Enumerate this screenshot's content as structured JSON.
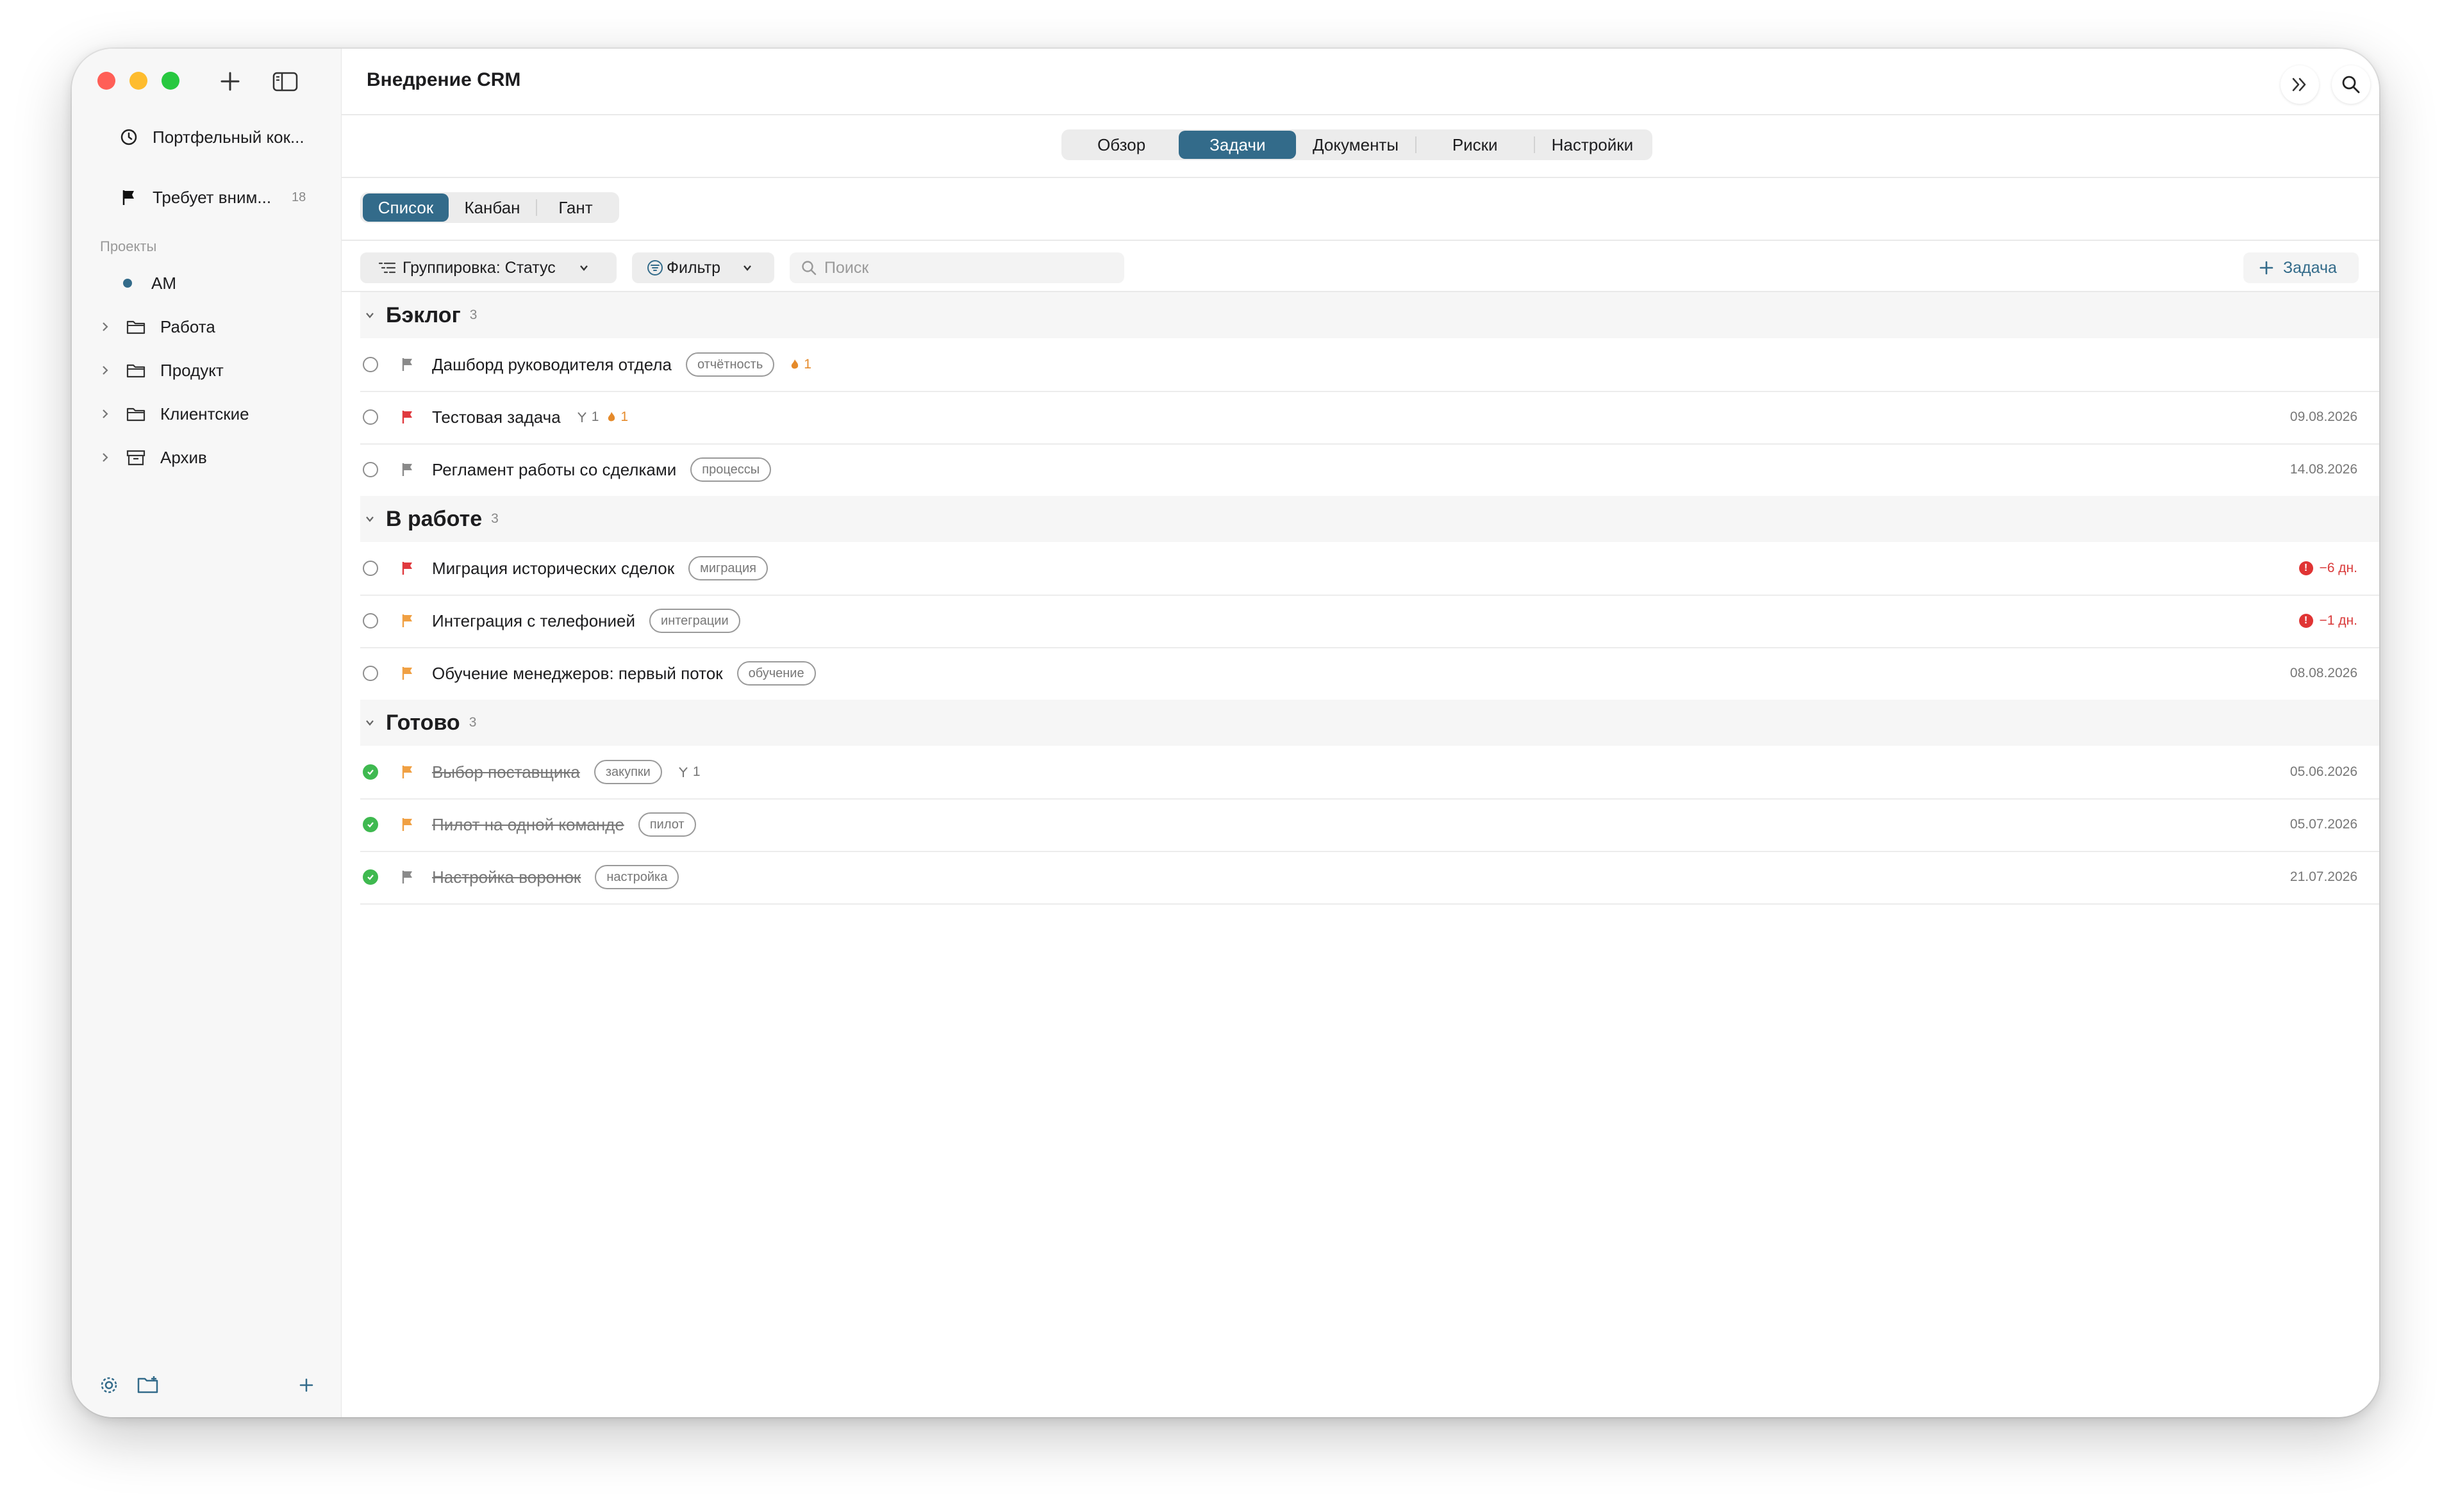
{
  "window": {
    "title": "Внедрение CRM"
  },
  "sidebar": {
    "top_items": [
      {
        "label": "Портфельный кок...",
        "icon": "clock-icon"
      },
      {
        "label": "Требует вним...",
        "icon": "flag-icon",
        "count": "18"
      }
    ],
    "section_label": "Проекты",
    "projects": [
      {
        "label": "AM",
        "icon": "dot-icon",
        "color": "#336b8a"
      },
      {
        "label": "Работа",
        "icon": "folder-icon"
      },
      {
        "label": "Продукт",
        "icon": "folder-icon"
      },
      {
        "label": "Клиентские",
        "icon": "folder-icon"
      },
      {
        "label": "Архив",
        "icon": "archive-icon"
      }
    ]
  },
  "tabs": [
    {
      "label": "Обзор",
      "active": false
    },
    {
      "label": "Задачи",
      "active": true
    },
    {
      "label": "Документы",
      "active": false
    },
    {
      "label": "Риски",
      "active": false
    },
    {
      "label": "Настройки",
      "active": false
    }
  ],
  "views": [
    {
      "label": "Список",
      "active": true
    },
    {
      "label": "Канбан",
      "active": false
    },
    {
      "label": "Гант",
      "active": false
    }
  ],
  "toolbar": {
    "group_label": "Группировка: Статус",
    "filter_label": "Фильтр",
    "search_placeholder": "Поиск",
    "add_label": "Задача"
  },
  "colors": {
    "accent": "#336b8a",
    "flag_red": "#e0393e",
    "flag_orange": "#f0a043",
    "flag_gray": "#8a8a8a",
    "done_green": "#3fb950",
    "overdue_red": "#d93a3a"
  },
  "groups": [
    {
      "title": "Бэклог",
      "count": "3",
      "tasks": [
        {
          "name": "Дашборд руководителя отдела",
          "flag": "gray",
          "done": false,
          "tag": "отчётность",
          "fire": "1",
          "date": ""
        },
        {
          "name": "Тестовая задача",
          "flag": "red",
          "done": false,
          "subtasks": "1",
          "fire": "1",
          "date": "09.08.2026"
        },
        {
          "name": "Регламент работы со сделками",
          "flag": "gray",
          "done": false,
          "tag": "процессы",
          "date": "14.08.2026"
        }
      ]
    },
    {
      "title": "В работе",
      "count": "3",
      "tasks": [
        {
          "name": "Миграция исторических сделок",
          "flag": "red",
          "done": false,
          "tag": "миграция",
          "overdue": "−6 дн."
        },
        {
          "name": "Интеграция с телефонией",
          "flag": "orange",
          "done": false,
          "tag": "интеграции",
          "overdue": "−1 дн."
        },
        {
          "name": "Обучение менеджеров: первый поток",
          "flag": "orange",
          "done": false,
          "tag": "обучение",
          "date": "08.08.2026"
        }
      ]
    },
    {
      "title": "Готово",
      "count": "3",
      "tasks": [
        {
          "name": "Выбор поставщика",
          "flag": "orange",
          "done": true,
          "tag": "закупки",
          "subtasks": "1",
          "date": "05.06.2026"
        },
        {
          "name": "Пилот на одной команде",
          "flag": "orange",
          "done": true,
          "tag": "пилот",
          "date": "05.07.2026"
        },
        {
          "name": "Настройка воронок",
          "flag": "gray",
          "done": true,
          "tag": "настройка",
          "date": "21.07.2026"
        }
      ]
    }
  ]
}
